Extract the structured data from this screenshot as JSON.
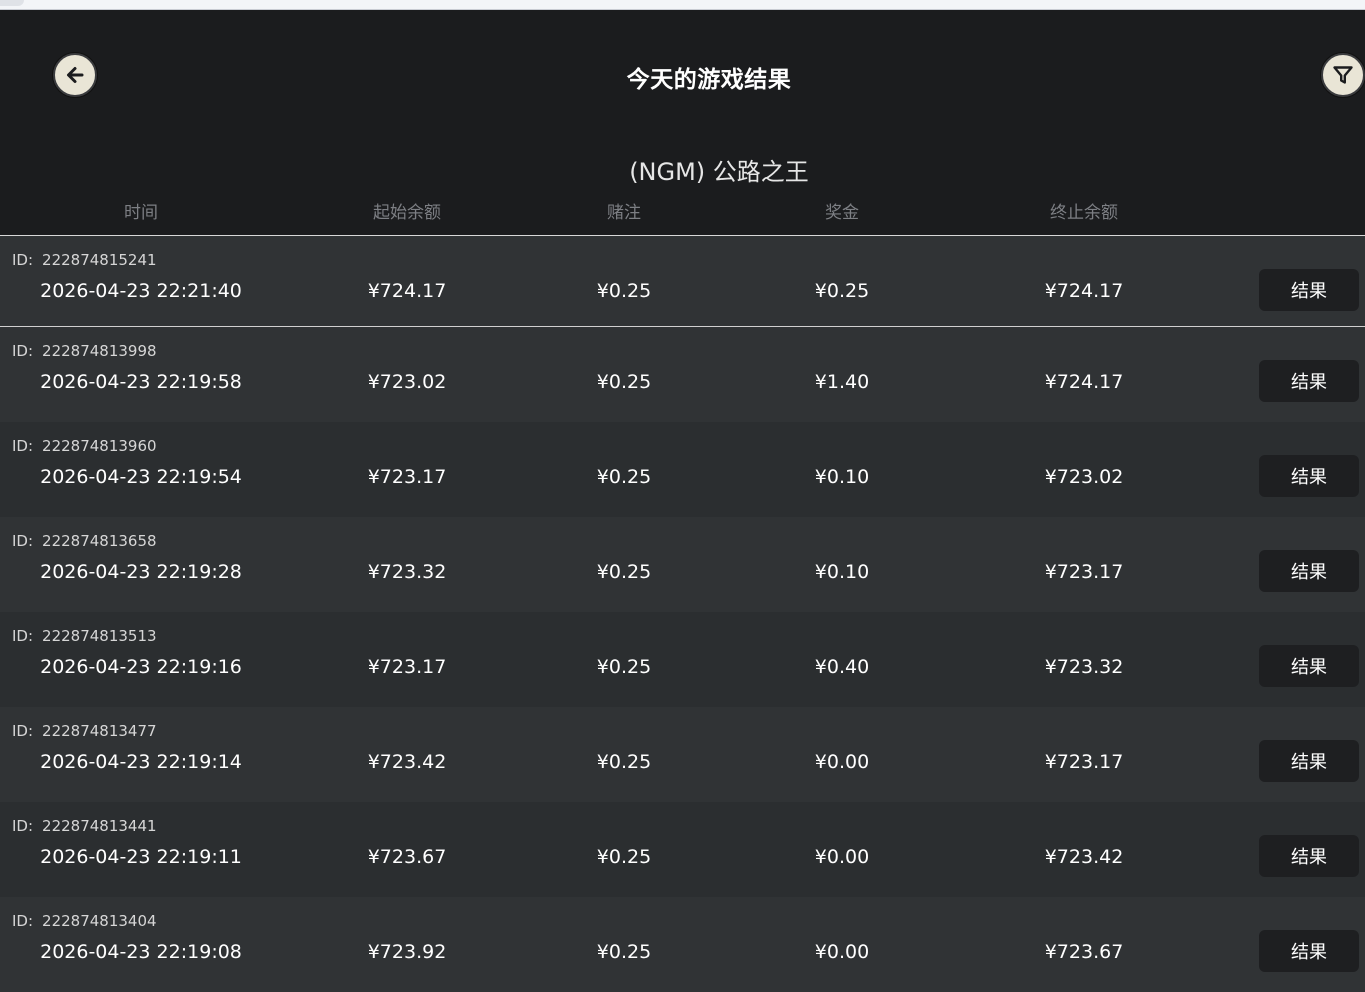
{
  "header": {
    "title": "今天的游戏结果",
    "back_icon": "arrow-left-icon",
    "filter_icon": "filter-icon"
  },
  "game": {
    "name": "(NGM) 公路之王"
  },
  "columns": {
    "time": "时间",
    "start_balance": "起始余额",
    "bet": "赌注",
    "prize": "奖金",
    "end_balance": "终止余额"
  },
  "id_prefix": "ID:",
  "result_label": "结果",
  "rows": [
    {
      "id": "222874815241",
      "time": "2026-04-23 22:21:40",
      "start": "¥724.17",
      "bet": "¥0.25",
      "prize": "¥0.25",
      "end": "¥724.17"
    },
    {
      "id": "222874813998",
      "time": "2026-04-23 22:19:58",
      "start": "¥723.02",
      "bet": "¥0.25",
      "prize": "¥1.40",
      "end": "¥724.17"
    },
    {
      "id": "222874813960",
      "time": "2026-04-23 22:19:54",
      "start": "¥723.17",
      "bet": "¥0.25",
      "prize": "¥0.10",
      "end": "¥723.02"
    },
    {
      "id": "222874813658",
      "time": "2026-04-23 22:19:28",
      "start": "¥723.32",
      "bet": "¥0.25",
      "prize": "¥0.10",
      "end": "¥723.17"
    },
    {
      "id": "222874813513",
      "time": "2026-04-23 22:19:16",
      "start": "¥723.17",
      "bet": "¥0.25",
      "prize": "¥0.40",
      "end": "¥723.32"
    },
    {
      "id": "222874813477",
      "time": "2026-04-23 22:19:14",
      "start": "¥723.42",
      "bet": "¥0.25",
      "prize": "¥0.00",
      "end": "¥723.17"
    },
    {
      "id": "222874813441",
      "time": "2026-04-23 22:19:11",
      "start": "¥723.67",
      "bet": "¥0.25",
      "prize": "¥0.00",
      "end": "¥723.42"
    },
    {
      "id": "222874813404",
      "time": "2026-04-23 22:19:08",
      "start": "¥723.92",
      "bet": "¥0.25",
      "prize": "¥0.00",
      "end": "¥723.67"
    }
  ]
}
